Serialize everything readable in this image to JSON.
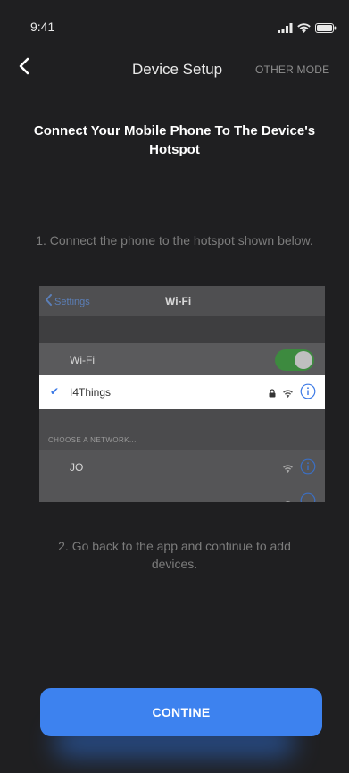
{
  "status_bar": {
    "time": "9:41"
  },
  "nav": {
    "title": "Device Setup",
    "other_mode": "OTHER MODE"
  },
  "headline": "Connect Your Mobile Phone To The Device's Hotspot",
  "steps": {
    "step1": "1. Connect the phone to the hotspot shown below.",
    "step2": "2. Go back to the app and continue to add devices."
  },
  "wifi_panel": {
    "back_label": "Settings",
    "title": "Wi-Fi",
    "wifi_row_label": "Wi-Fi",
    "wifi_enabled": true,
    "selected_network": "I4Things",
    "section_label": "CHOOSE A NETWORK...",
    "networks": [
      {
        "name": "JO"
      },
      {
        "name": ""
      }
    ]
  },
  "buttons": {
    "continue": "CONTINE"
  },
  "colors": {
    "background": "#1f1f21",
    "accent": "#3d82ef",
    "toggle_on": "#3d8a3f",
    "link": "#3b79e6"
  }
}
